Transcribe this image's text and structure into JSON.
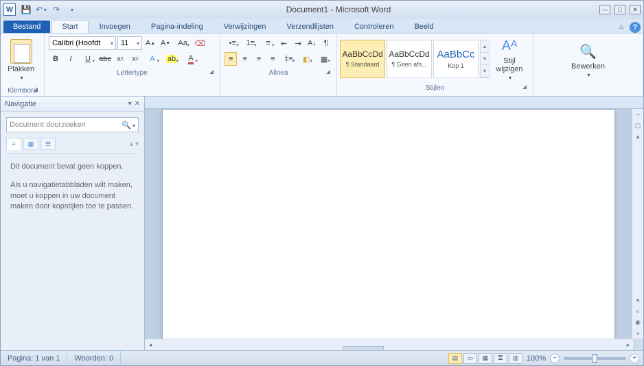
{
  "title": "Document1 - Microsoft Word",
  "tabs": {
    "file": "Bestand",
    "items": [
      "Start",
      "Invoegen",
      "Pagina-indeling",
      "Verwijzingen",
      "Verzendlijsten",
      "Controleren",
      "Beeld"
    ],
    "active_index": 0
  },
  "clipboard": {
    "paste": "Plakken",
    "label": "Klembord"
  },
  "font": {
    "name": "Calibri (Hoofdt",
    "size": "11",
    "label": "Lettertype"
  },
  "paragraph": {
    "label": "Alinea"
  },
  "styles": {
    "label": "Stijlen",
    "items": [
      {
        "preview": "AaBbCcDd",
        "name": "¶ Standaard",
        "sel": true,
        "klass": "black"
      },
      {
        "preview": "AaBbCcDd",
        "name": "¶ Geen afs...",
        "sel": false,
        "klass": "black"
      },
      {
        "preview": "AaBbCc",
        "name": "Kop 1",
        "sel": false,
        "klass": "big"
      }
    ],
    "change": "Stijl wijzigen"
  },
  "editing": {
    "label": "Bewerken"
  },
  "nav": {
    "title": "Navigatie",
    "placeholder": "Document doorzoeken",
    "msg1": "Dit document bevat geen koppen.",
    "msg2": "Als u navigatietabbladen wilt maken, moet u koppen in uw document maken door kopstijlen toe te passen."
  },
  "status": {
    "page": "Pagina: 1 van 1",
    "words": "Woorden: 0",
    "zoom": "100%"
  }
}
